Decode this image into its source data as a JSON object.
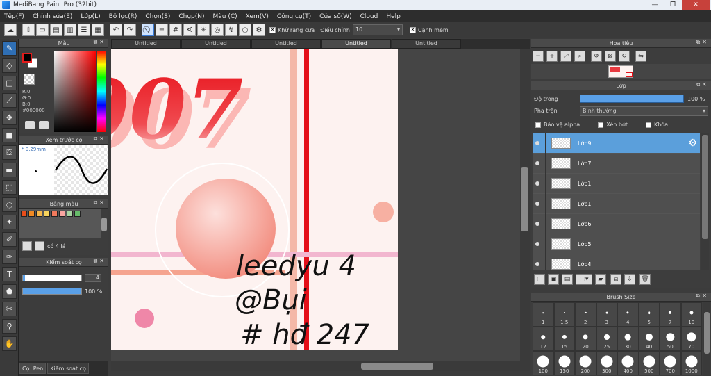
{
  "window": {
    "title": "MediBang Paint Pro (32bit)",
    "controls": [
      "—",
      "❐",
      "✕"
    ]
  },
  "menu": [
    "Tệp(F)",
    "Chỉnh sửa(E)",
    "Lớp(L)",
    "Bộ lọc(R)",
    "Chọn(S)",
    "Chụp(N)",
    "Màu (C)",
    "Xem(V)",
    "Công cụ(T)",
    "Cửa sổ(W)",
    "Cloud",
    "Help"
  ],
  "toolbar": {
    "antialias_label": "Khử răng cưa",
    "adjust_label": "Điều chỉnh",
    "adjust_value": "10",
    "edge_label": "Cạnh mềm"
  },
  "color_panel": {
    "title": "Màu",
    "r": "R:0",
    "g": "G:0",
    "b": "B:0",
    "hex": "#000000",
    "fg": "#000000",
    "bg": "#ffffff"
  },
  "preview_panel": {
    "title": "Xem trước cọ",
    "size": "0.29mm"
  },
  "palette_panel": {
    "title": "Bảng màu",
    "colors": [
      "#e94e1b",
      "#f08a24",
      "#f6b84c",
      "#f7d35c",
      "#f27a5d",
      "#f9a6a1",
      "#a8d5a2",
      "#66bb6a"
    ],
    "count_label": "có 4 lá"
  },
  "control_panel": {
    "title": "Kiểm soát cọ",
    "size_value": "4",
    "opacity_value": "100 %",
    "size_fraction": 0.03,
    "opacity_fraction": 1.0
  },
  "left_tabs": [
    "Cọ: Pen",
    "Kiểm soát cọ"
  ],
  "doc_tabs": [
    "Untitled",
    "Untitled",
    "Untitled",
    "Untitled",
    "Untitled"
  ],
  "canvas": {
    "text_big": "007",
    "handwriting_1": "leedyu 4",
    "handwriting_2": "@Bụi",
    "handwriting_3": "# hđ 247"
  },
  "navigator": {
    "title": "Hoa tiêu"
  },
  "layers": {
    "title": "Lớp",
    "opacity_label": "Độ trong",
    "opacity_value": "100 %",
    "blend_label": "Pha trộn",
    "blend_value": "Bình thường",
    "checks": [
      "Bảo vệ alpha",
      "Xén bớt",
      "Khóa"
    ],
    "items": [
      {
        "name": "Lớp9",
        "selected": true
      },
      {
        "name": "Lớp7",
        "selected": false
      },
      {
        "name": "Lớp1",
        "selected": false
      },
      {
        "name": "Lớp1",
        "selected": false
      },
      {
        "name": "Lớp6",
        "selected": false
      },
      {
        "name": "Lớp5",
        "selected": false
      },
      {
        "name": "Lớp4",
        "selected": false
      }
    ]
  },
  "brush_size": {
    "title": "Brush Size",
    "sizes": [
      "1",
      "1.5",
      "2",
      "3",
      "4",
      "5",
      "7",
      "10",
      "12",
      "15",
      "20",
      "25",
      "30",
      "40",
      "50",
      "70",
      "100",
      "150",
      "200",
      "300",
      "400",
      "500",
      "700",
      "1000"
    ]
  }
}
